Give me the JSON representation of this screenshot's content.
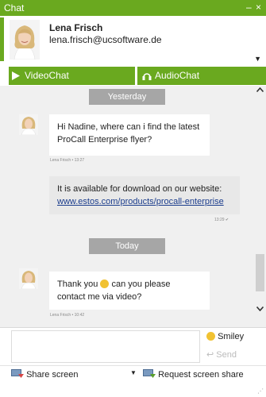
{
  "window": {
    "title": "Chat",
    "minimize": "–",
    "close": "×"
  },
  "contact": {
    "name": "Lena Frisch",
    "email": "lena.frisch@ucsoftware.de"
  },
  "call_buttons": {
    "video": "VideoChat",
    "audio": "AudioChat"
  },
  "messages": {
    "day1": "Yesterday",
    "msg1": {
      "line1": "Hi Nadine, where can i find the latest",
      "line2": "ProCall Enterprise flyer?",
      "meta": "Lena Frisch • 13:27"
    },
    "msg2": {
      "line1": "It is available for download on our website:",
      "link": "www.estos.com/products/procall-enterprise",
      "meta": "13:29 ✔"
    },
    "day2": "Today",
    "msg3": {
      "before": "Thank you",
      "after": "can you please",
      "line2": "contact me via video?",
      "meta": "Lena Frisch • 10:42"
    }
  },
  "input": {
    "smiley": "Smiley",
    "send": "Send"
  },
  "bottom": {
    "share": "Share screen",
    "request": "Request screen share"
  },
  "colors": {
    "accent": "#6aa91f",
    "day_label": "#a6a6a6"
  }
}
